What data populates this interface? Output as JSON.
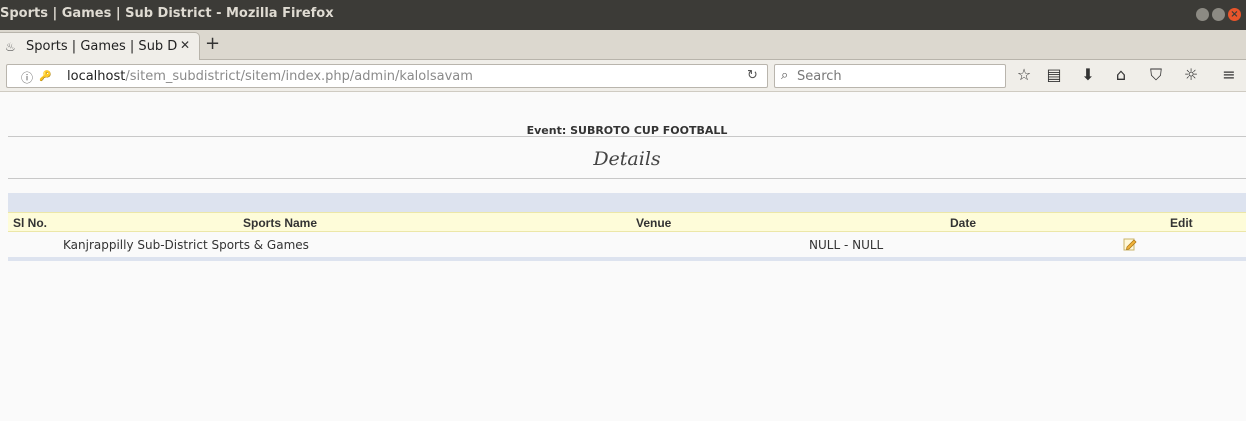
{
  "window": {
    "title": "Sports | Games | Sub District - Mozilla Firefox",
    "close_glyph": "×"
  },
  "tab": {
    "favicon": "♨",
    "label": "Sports | Games | Sub Di",
    "close": "✕",
    "new_tab": "+"
  },
  "nav": {
    "url_host": "localhost",
    "url_path": "/sitem_subdistrict/sitem/index.php/admin/kalolsavam",
    "reload": "↻",
    "search_placeholder": "Search",
    "search_icon": "⌕",
    "info_icon": "ⓘ",
    "key_icon": "🔑",
    "toolbar": {
      "bookmark": "☆",
      "library": "▤",
      "download": "⬇",
      "home": "⌂",
      "pocket": "⛉",
      "addon": "☼",
      "menu": "≡"
    }
  },
  "content": {
    "event_label": "Event: SUBROTO CUP FOOTBALL",
    "section_title": "Details",
    "table": {
      "columns": [
        "Sl No.",
        "Sports Name",
        "Venue",
        "Date",
        "Edit"
      ],
      "rows": [
        {
          "sl_no": "",
          "sports_name": "Kanjrappilly Sub-District Sports & Games",
          "venue": "",
          "date": "NULL  -  NULL",
          "edit_icon": "edit-pencil-icon"
        }
      ]
    }
  },
  "colors": {
    "titlebar": "#3c3b37",
    "close_button": "#e9552b",
    "header_row": "#fefcd9",
    "blue_bar": "#dde3ef"
  }
}
